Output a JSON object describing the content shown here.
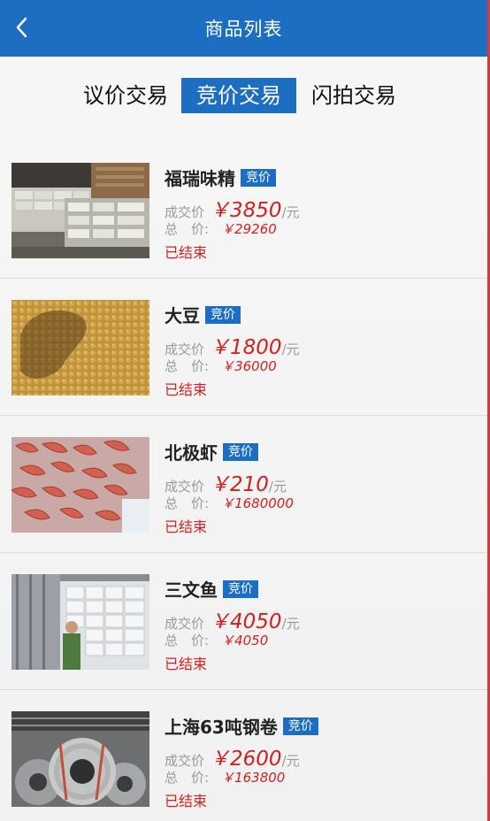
{
  "header": {
    "title": "商品列表",
    "back_icon": "chevron-left-icon"
  },
  "tabs": [
    {
      "label": "议价交易",
      "active": false
    },
    {
      "label": "竞价交易",
      "active": true
    },
    {
      "label": "闪拍交易",
      "active": false
    }
  ],
  "colors": {
    "primary": "#1b6ec1",
    "price": "#d51f1f",
    "label": "#9a9a9a",
    "edge": "#d93a35"
  },
  "items": [
    {
      "name": "福瑞味精",
      "badge": "竞价",
      "price_label": "成交价",
      "price": "￥3850",
      "unit": "/元",
      "total_label": "总　价:",
      "total": "￥29260",
      "status": "已结束"
    },
    {
      "name": "大豆",
      "badge": "竞价",
      "price_label": "成交价",
      "price": "￥1800",
      "unit": "/元",
      "total_label": "总　价:",
      "total": "￥36000",
      "status": "已结束"
    },
    {
      "name": "北极虾",
      "badge": "竞价",
      "price_label": "成交价",
      "price": "￥210",
      "unit": "/元",
      "total_label": "总　价:",
      "total": "￥1680000",
      "status": "已结束"
    },
    {
      "name": "三文鱼",
      "badge": "竞价",
      "price_label": "成交价",
      "price": "￥4050",
      "unit": "/元",
      "total_label": "总　价:",
      "total": "￥4050",
      "status": "已结束"
    },
    {
      "name": "上海63吨钢卷",
      "badge": "竞价",
      "price_label": "成交价",
      "price": "￥2600",
      "unit": "/元",
      "total_label": "总　价:",
      "total": "￥163800",
      "status": "已结束"
    }
  ]
}
